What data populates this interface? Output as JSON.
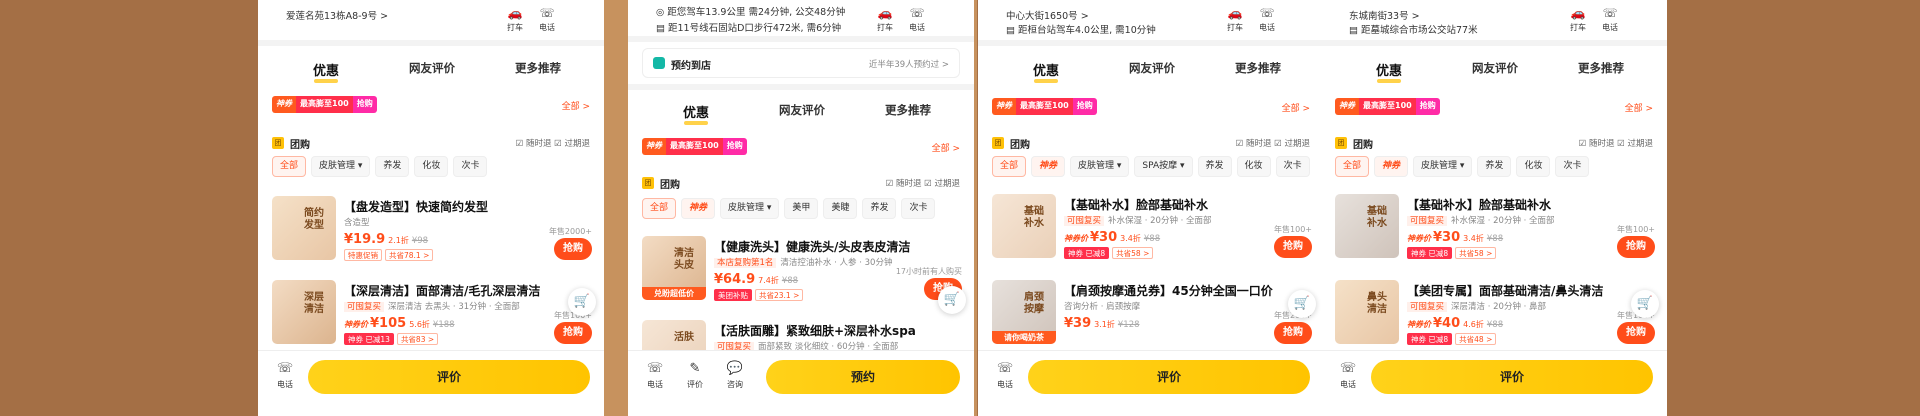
{
  "colors": {
    "accent": "#ff4d1a",
    "cta_yellow": "#ffc400",
    "brand_pink": "#ff2ba6",
    "background": "#a46f45"
  },
  "panels": [
    {
      "address_lines": [
        "爱莲名苑13栋A8-9号 >"
      ],
      "actions": [
        {
          "icon": "car-icon",
          "label": "打车"
        },
        {
          "icon": "phone-icon",
          "label": "电话"
        }
      ],
      "tabs": [
        "优惠",
        "网友评价",
        "更多推荐"
      ],
      "promo": [
        "神券",
        "最高膨至100",
        "抢购"
      ],
      "all_label": "全部 >",
      "tuangou": {
        "title": "团购",
        "right": "☑ 随时退  ☑ 过期退"
      },
      "chips": [
        "全部",
        "皮肤管理 ▾",
        "养发",
        "化妆",
        "次卡"
      ],
      "items": [
        {
          "thumb_text": "简约发型",
          "title": "【盘发造型】快速简约发型",
          "sub": "含造型",
          "sold": "年售2000+",
          "price_prefix": "",
          "price": "¥19.9",
          "discount": "2.1折",
          "orig": "¥98",
          "tags": [
            "特惠促销",
            "共省78.1 >"
          ],
          "buy": "抢购"
        },
        {
          "thumb_text": "深层清洁",
          "title": "【深层清洁】面部清洁/毛孔深层清洁",
          "sub_tag": "可囤复买",
          "sub": "深层清洁 去黑头 · 31分钟 · 全面部",
          "sold": "年售100+",
          "price_prefix": "神券价",
          "price": "¥105",
          "discount": "5.6折",
          "orig": "¥188",
          "tags": [
            "神券 已减13",
            "共省83 >"
          ],
          "buy": "抢购"
        }
      ],
      "bottom": {
        "icons": [
          {
            "icon": "phone-icon",
            "label": "电话"
          }
        ],
        "cta": "评价"
      }
    },
    {
      "address_lines": [
        "◎ 距您驾车13.9公里 需24分钟, 公交48分钟",
        "▤ 距11号线石固站D口步行472米, 需6分钟"
      ],
      "actions": [
        {
          "icon": "car-icon",
          "label": "打车"
        },
        {
          "icon": "phone-icon",
          "label": "电话"
        }
      ],
      "booking": {
        "title": "预约到店",
        "right": "近半年39人预约过 >"
      },
      "tabs": [
        "优惠",
        "网友评价",
        "更多推荐"
      ],
      "promo": [
        "神券",
        "最高膨至100",
        "抢购"
      ],
      "all_label": "全部 >",
      "tuangou": {
        "title": "团购",
        "right": "☑ 随时退  ☑ 过期退"
      },
      "chips": [
        "全部",
        "神券",
        "皮肤管理 ▾",
        "美甲",
        "美睫",
        "养发",
        "次卡"
      ],
      "items": [
        {
          "thumb_text": "清洁头皮",
          "thumb_band": "兑盼超低价",
          "title": "【健康洗头】健康洗头/头皮表皮清洁",
          "sub_tag": "本店复购第1名",
          "sub": "清洁控油补水 · 人参 · 30分钟",
          "sold": "17小时前有人购买",
          "price_prefix": "",
          "price": "¥64.9",
          "discount": "7.4折",
          "orig": "¥88",
          "tags": [
            "美团补贴",
            "共省23.1 >"
          ],
          "buy": "抢购"
        },
        {
          "thumb_text": "活肤",
          "title": "【活肤面雕】紧致细肤+深层补水spa",
          "sub_tag": "可囤复买",
          "sub": "面部紧致 淡化细纹 · 60分钟 · 全面部",
          "sold": "",
          "price_prefix": "",
          "price": "",
          "discount": "",
          "orig": "",
          "tags": [],
          "buy": ""
        }
      ],
      "bottom": {
        "icons": [
          {
            "icon": "phone-icon",
            "label": "电话"
          },
          {
            "icon": "review-icon",
            "label": "评价"
          },
          {
            "icon": "chat-icon",
            "label": "咨询"
          }
        ],
        "cta": "预约"
      }
    },
    {
      "address_lines": [
        "中心大街1650号 >",
        "▤ 距桓台站驾车4.0公里, 需10分钟"
      ],
      "actions": [
        {
          "icon": "car-icon",
          "label": "打车"
        },
        {
          "icon": "phone-icon",
          "label": "电话"
        }
      ],
      "tabs": [
        "优惠",
        "网友评价",
        "更多推荐"
      ],
      "promo": [
        "神券",
        "最高膨至100",
        "抢购"
      ],
      "all_label": "全部 >",
      "tuangou": {
        "title": "团购",
        "right": "☑ 随时退  ☑ 过期退"
      },
      "chips": [
        "全部",
        "神券",
        "皮肤管理 ▾",
        "SPA按摩 ▾",
        "养发",
        "化妆",
        "次卡"
      ],
      "items": [
        {
          "thumb_text": "基础补水",
          "title": "【基础补水】脸部基础补水",
          "sub_tag": "可囤复买",
          "sub": "补水保湿 · 20分钟 · 全面部",
          "sold": "年售100+",
          "price_prefix": "神券价",
          "price": "¥30",
          "discount": "3.4折",
          "orig": "¥88",
          "tags": [
            "神券 已减8",
            "共省58 >"
          ],
          "buy": "抢购"
        },
        {
          "thumb_text": "肩颈按摩",
          "thumb_band": "请你喝奶茶",
          "title": "【肩颈按摩通兑券】45分钟全国一口价",
          "sub": "咨询分析 · 肩颈按摩",
          "sold": "年售200+",
          "price_prefix": "",
          "price": "¥39",
          "discount": "3.1折",
          "orig": "¥128",
          "tags": [],
          "buy": "抢购"
        }
      ],
      "bottom": {
        "icons": [
          {
            "icon": "phone-icon",
            "label": "电话"
          }
        ],
        "cta": "评价"
      }
    },
    {
      "address_lines": [
        "东城南街33号 >",
        "▤ 距墓城综合市场公交站77米"
      ],
      "actions": [
        {
          "icon": "car-icon",
          "label": "打车"
        },
        {
          "icon": "phone-icon",
          "label": "电话"
        }
      ],
      "tabs": [
        "优惠",
        "网友评价",
        "更多推荐"
      ],
      "promo": [
        "神券",
        "最高膨至100",
        "抢购"
      ],
      "all_label": "全部 >",
      "tuangou": {
        "title": "团购",
        "right": "☑ 随时退  ☑ 过期退"
      },
      "chips": [
        "全部",
        "神券",
        "皮肤管理 ▾",
        "养发",
        "化妆",
        "次卡"
      ],
      "items": [
        {
          "thumb_text": "基础补水",
          "title": "【基础补水】脸部基础补水",
          "sub_tag": "可囤复买",
          "sub": "补水保湿 · 20分钟 · 全面部",
          "sold": "年售100+",
          "price_prefix": "神券价",
          "price": "¥30",
          "discount": "3.4折",
          "orig": "¥88",
          "tags": [
            "神券 已减8",
            "共省58 >"
          ],
          "buy": "抢购"
        },
        {
          "thumb_text": "鼻头清洁",
          "title": "【美团专属】面部基础清洁/鼻头清洁",
          "sub_tag": "可囤复买",
          "sub": "深层清洁 · 20分钟 · 鼻部",
          "sold": "年售100+",
          "price_prefix": "神券价",
          "price": "¥40",
          "discount": "4.6折",
          "orig": "¥88",
          "tags": [
            "神券 已减8",
            "共省48 >"
          ],
          "buy": "抢购"
        }
      ],
      "bottom": {
        "icons": [
          {
            "icon": "phone-icon",
            "label": "电话"
          }
        ],
        "cta": "评价"
      }
    }
  ]
}
